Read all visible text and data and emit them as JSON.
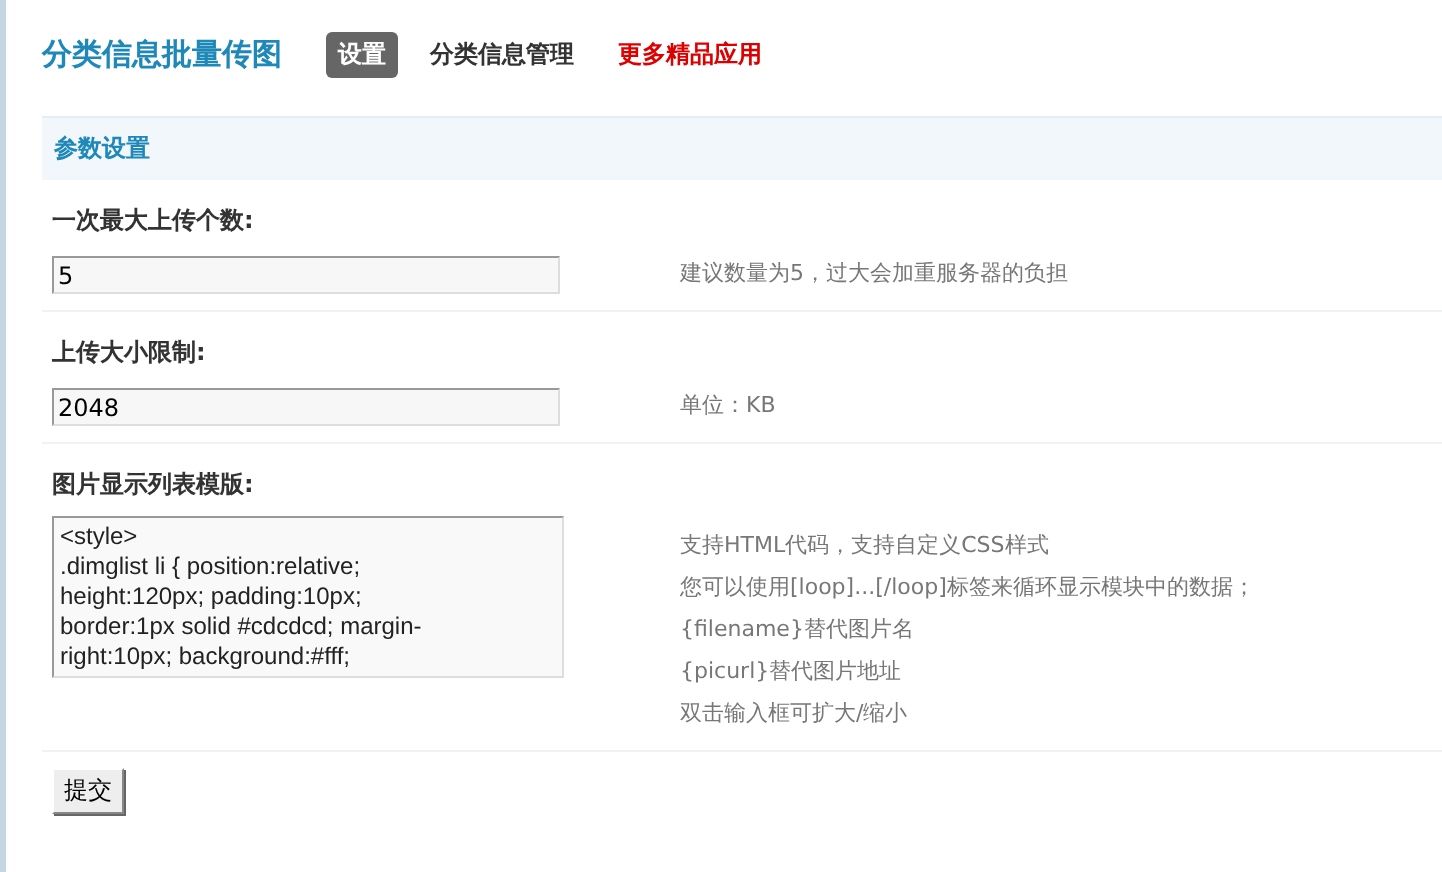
{
  "header": {
    "title": "分类信息批量传图",
    "tabs": [
      {
        "label": "设置",
        "selected": true
      },
      {
        "label": "分类信息管理",
        "selected": false
      }
    ],
    "promo_link": "更多精品应用"
  },
  "section": {
    "title": "参数设置"
  },
  "fields": [
    {
      "kind": "input",
      "label": "一次最大上传个数:",
      "value": "5",
      "hint": [
        "建议数量为5，过大会加重服务器的负担"
      ]
    },
    {
      "kind": "input",
      "label": "上传大小限制:",
      "value": "2048",
      "hint": [
        "单位：KB"
      ]
    },
    {
      "kind": "textarea",
      "label": "图片显示列表模版:",
      "value": "<style>\n.dimglist li { position:relative;\nheight:120px; padding:10px;\nborder:1px solid #cdcdcd; margin-\nright:10px; background:#fff;",
      "hint": [
        "支持HTML代码，支持自定义CSS样式",
        "您可以使用[loop]...[/loop]标签来循环显示模块中的数据；",
        "{filename}替代图片名",
        "{picurl}替代图片地址",
        "双击输入框可扩大/缩小"
      ]
    }
  ],
  "submit": "提交"
}
